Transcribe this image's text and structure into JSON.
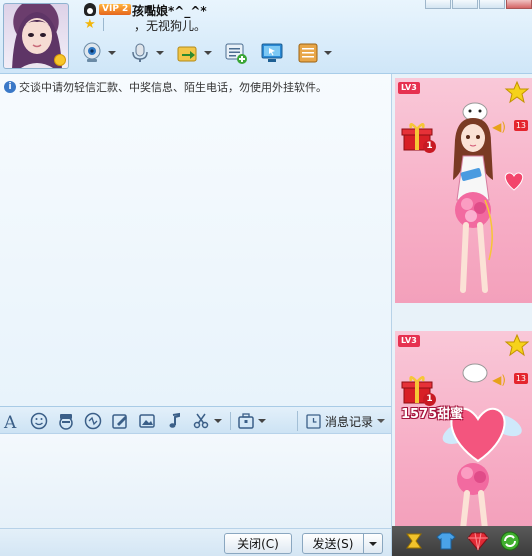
{
  "window": {
    "minimize_label": "",
    "maximize_label": "",
    "close_label": ""
  },
  "profile": {
    "vip_level": "VIP 2",
    "nickname": "孩嚸娘*^_^*",
    "signature": "，无视狗儿。"
  },
  "toolbar": {
    "items": [
      {
        "icon": "webcam-icon"
      },
      {
        "icon": "microphone-icon"
      },
      {
        "icon": "file-transfer-icon"
      },
      {
        "icon": "group-chat-icon"
      },
      {
        "icon": "remote-desktop-icon"
      },
      {
        "icon": "app-box-icon"
      }
    ]
  },
  "chat": {
    "notice": "交谈中请勿轻信汇款、中奖信息、陌生电话，勿使用外挂软件。"
  },
  "input_toolbar": {
    "history_label": "消息记录"
  },
  "buttons": {
    "close": "关闭(C)",
    "send": "发送(S)"
  },
  "show_panels": [
    {
      "level": "LV3",
      "gift_count": "1",
      "badge": "13"
    },
    {
      "level": "LV3",
      "gift_count": "1",
      "badge": "13",
      "sweet": "1575甜蜜"
    }
  ],
  "colors": {
    "accent": "#3a78c7",
    "panel_pink": "#f7aec6",
    "vip_orange": "#e5661e"
  }
}
